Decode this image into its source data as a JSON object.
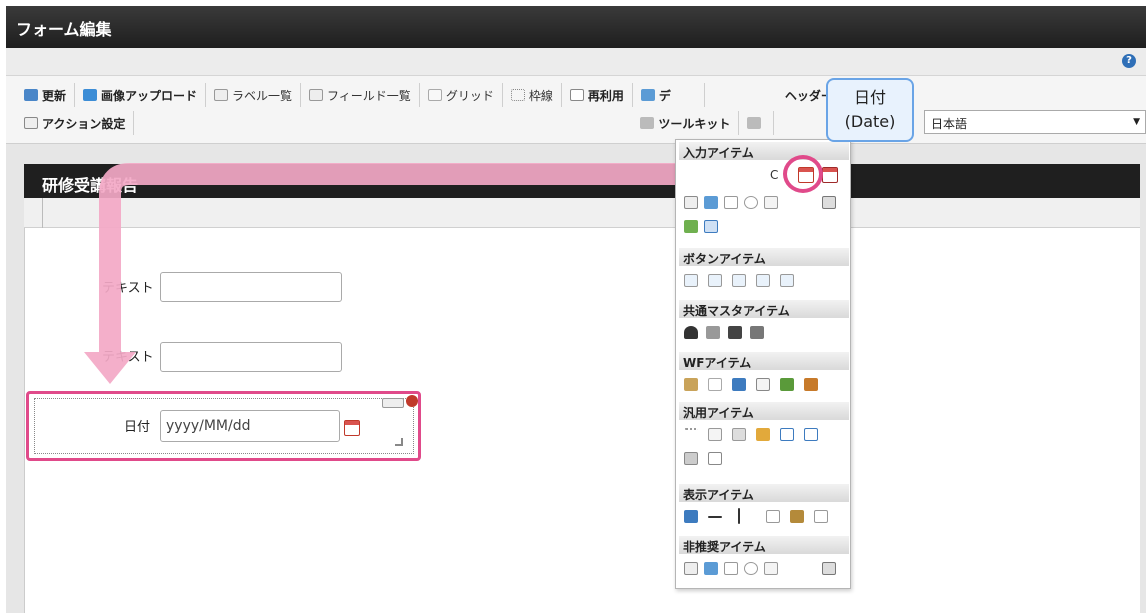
{
  "window": {
    "title": "フォーム編集"
  },
  "help": {
    "icon": "help-icon",
    "glyph": "?"
  },
  "toolbar": {
    "row1": [
      "更新",
      "画像アップロード",
      "ラベル一覧",
      "フィールド一覧",
      "グリッド",
      "枠線",
      "再利用",
      "デ",
      "ヘッダーとフッター"
    ],
    "row2": [
      "アクション設定",
      "ツールキット"
    ],
    "language": "日本語"
  },
  "form": {
    "title": "研修受講報告",
    "fields": [
      {
        "label": "テキスト"
      },
      {
        "label": "テキスト"
      },
      {
        "label": "日付",
        "placeholder": "yyyy/MM/dd"
      }
    ]
  },
  "palette": {
    "sections": [
      "入力アイテム",
      "ボタンアイテム",
      "共通マスタアイテム",
      "WFアイテム",
      "汎用アイテム",
      "表示アイテム",
      "非推奨アイテム"
    ],
    "input_first_glyph": "C"
  },
  "callout": {
    "line1": "日付",
    "line2": "(Date)"
  },
  "colors": {
    "accent": "#e04a8a",
    "callout_border": "#6aa4e6",
    "header": "#1f1f1f"
  }
}
